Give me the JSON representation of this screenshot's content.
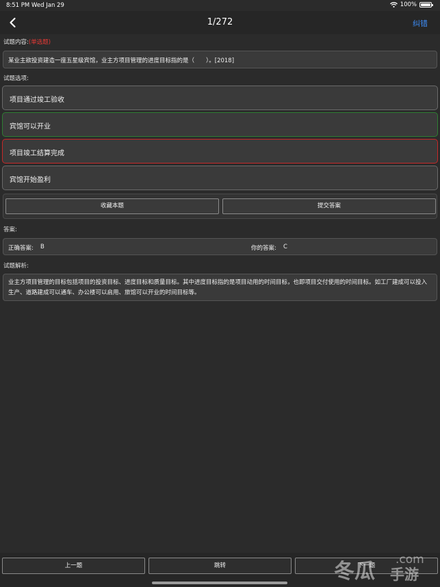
{
  "status": {
    "time": "8:51 PM",
    "date": "Wed Jan 29",
    "battery": "100%"
  },
  "nav": {
    "title": "1/272",
    "report_label": "纠错",
    "back_icon": "chevron-left-icon"
  },
  "question_section": {
    "label": "试题内容:",
    "type_tag": "(单选题)",
    "text": "某业主欲投资建造一座五星级宾馆，业主方项目管理的进度目标指的是（　　）。[2018]"
  },
  "options_section": {
    "label": "试题选项:",
    "options": [
      {
        "text": "项目通过竣工验收",
        "state": "normal"
      },
      {
        "text": "宾馆可以开业",
        "state": "correct"
      },
      {
        "text": "项目竣工结算完成",
        "state": "wrong"
      },
      {
        "text": "宾馆开始盈利",
        "state": "normal"
      }
    ]
  },
  "actions": {
    "favorite_label": "收藏本题",
    "submit_label": "提交答案"
  },
  "answer_section": {
    "label": "答案:",
    "correct_label": "正确答案:",
    "correct_value": "B",
    "yours_label": "你的答案:",
    "yours_value": "C"
  },
  "analysis_section": {
    "label": "试题解析:",
    "text": "业主方项目管理的目标包括项目的投资目标、进度目标和质量目标。其中进度目标指的是项目动用的时间目标，也即项目交付使用的时间目标。如工厂建成可以投入生产、道路建成可以通车、办公楼可以启用、旅馆可以开业的时间目标等。"
  },
  "bottom": {
    "prev_label": "上一题",
    "jump_label": "跳转",
    "next_label": "下一题"
  },
  "watermark": {
    "brand": "冬瓜",
    "domain": ".com",
    "suffix": "手游"
  },
  "colors": {
    "accent": "#3d8cf5",
    "correct": "#2e7d32",
    "wrong": "#c62828",
    "tag": "#e53935"
  }
}
